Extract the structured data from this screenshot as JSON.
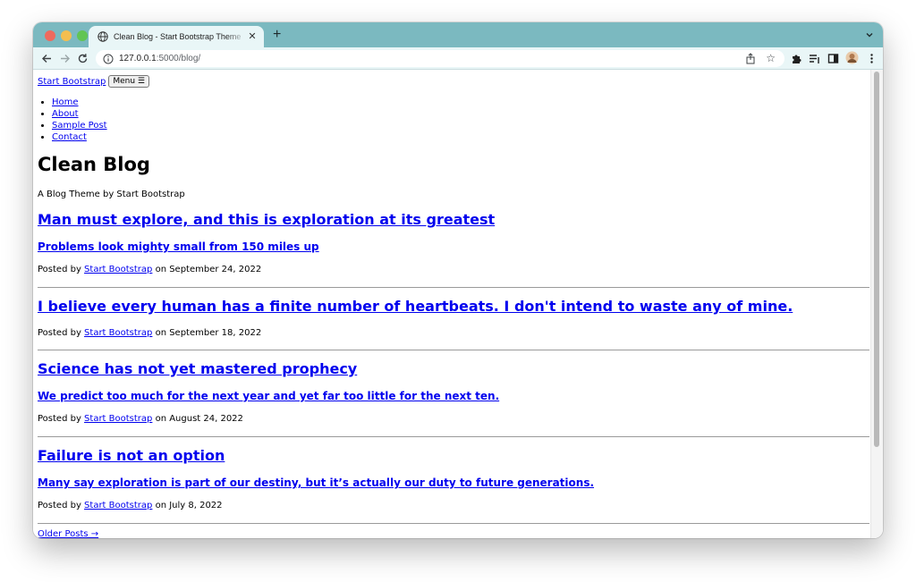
{
  "browser": {
    "tab_title": "Clean Blog - Start Bootstrap Theme",
    "new_tab_label": "+",
    "url_host": "127.0.0.1",
    "url_rest": ":5000/blog/"
  },
  "site": {
    "brand": "Start Bootstrap",
    "menu_button": "Menu ☰",
    "nav": [
      "Home",
      "About",
      "Sample Post",
      "Contact"
    ],
    "title": "Clean Blog",
    "subtitle": "A Blog Theme by Start Bootstrap"
  },
  "posts": [
    {
      "title": "Man must explore, and this is exploration at its greatest",
      "subtitle": "Problems look mighty small from 150 miles up",
      "meta_prefix": "Posted by ",
      "author": "Start Bootstrap",
      "meta_suffix": " on September 24, 2022"
    },
    {
      "title": "I believe every human has a finite number of heartbeats. I don't intend to waste any of mine.",
      "subtitle": "",
      "meta_prefix": "Posted by ",
      "author": "Start Bootstrap",
      "meta_suffix": " on September 18, 2022"
    },
    {
      "title": "Science has not yet mastered prophecy",
      "subtitle": "We predict too much for the next year and yet far too little for the next ten.",
      "meta_prefix": "Posted by ",
      "author": "Start Bootstrap",
      "meta_suffix": " on August 24, 2022"
    },
    {
      "title": "Failure is not an option",
      "subtitle": "Many say exploration is part of our destiny, but it’s actually our duty to future generations.",
      "meta_prefix": "Posted by ",
      "author": "Start Bootstrap",
      "meta_suffix": " on July 8, 2022"
    }
  ],
  "pager": {
    "older": "Older Posts →"
  },
  "colors": {
    "tabstrip": "#7bb9c0",
    "toolbar": "#e9f6f7",
    "link": "#0000ee"
  },
  "icons": [
    "globe-icon",
    "close-icon",
    "back-icon",
    "forward-icon",
    "reload-icon",
    "info-icon",
    "share-icon",
    "star-icon",
    "extensions-icon",
    "reading-list-icon",
    "side-panel-icon",
    "profile-avatar-icon",
    "more-menu-icon",
    "tab-search-icon"
  ]
}
